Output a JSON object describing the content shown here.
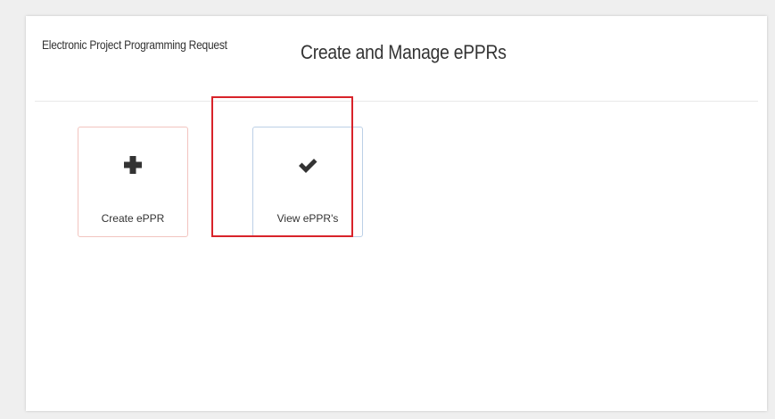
{
  "header": {
    "app_name": "Electronic Project Programming Request",
    "page_title": "Create and Manage ePPRs"
  },
  "tiles": [
    {
      "label": "Create ePPR",
      "icon": "plus-icon"
    },
    {
      "label": "View ePPR's",
      "icon": "checkmark-icon"
    }
  ],
  "colors": {
    "background": "#efefef",
    "panel": "#ffffff",
    "text": "#333333",
    "icon": "#333333",
    "create_tile_border": "#f2c4bf",
    "view_tile_border": "#bcd0e6",
    "highlight": "#d8232a"
  }
}
